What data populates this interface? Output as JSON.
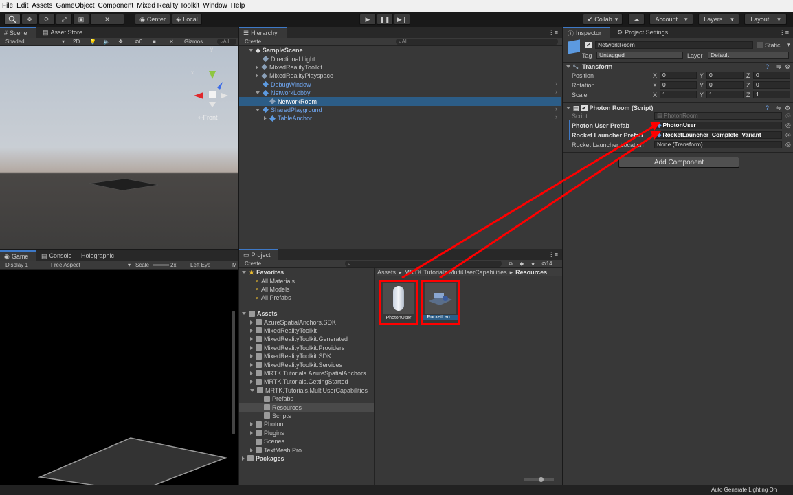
{
  "menu": [
    "File",
    "Edit",
    "Assets",
    "GameObject",
    "Component",
    "Mixed Reality Toolkit",
    "Window",
    "Help"
  ],
  "toolbar": {
    "center": "Center",
    "local": "Local",
    "collab": "Collab",
    "account": "Account",
    "layers": "Layers",
    "layout": "Layout"
  },
  "scene": {
    "tabs": [
      "Scene",
      "Asset Store"
    ],
    "shaded": "Shaded",
    "mode2d": "2D",
    "effects_count": "0",
    "gizmos": "Gizmos",
    "search_placeholder": "All",
    "gizmo_label": "Front",
    "axis_x": "x",
    "axis_y": "y"
  },
  "game": {
    "tabs": [
      "Game",
      "Console",
      "Holographic"
    ],
    "display": "Display 1",
    "aspect": "Free Aspect",
    "scale_label": "Scale",
    "scale_value": "2x",
    "eye": "Left Eye",
    "more": "M"
  },
  "hierarchy": {
    "tab": "Hierarchy",
    "create": "Create",
    "search_placeholder": "All",
    "scene_name": "SampleScene",
    "items": [
      {
        "label": "Directional Light"
      },
      {
        "label": "MixedRealityToolkit"
      },
      {
        "label": "MixedRealityPlayspace"
      },
      {
        "label": "DebugWindow"
      },
      {
        "label": "NetworkLobby"
      },
      {
        "label": "NetworkRoom"
      },
      {
        "label": "SharedPlayground"
      },
      {
        "label": "TableAnchor"
      }
    ]
  },
  "project": {
    "tab": "Project",
    "create": "Create",
    "badge_count": "14",
    "favorites_title": "Favorites",
    "favorites": [
      "All Materials",
      "All Models",
      "All Prefabs"
    ],
    "assets_title": "Assets",
    "folders": [
      "AzureSpatialAnchors.SDK",
      "MixedRealityToolkit",
      "MixedRealityToolkit.Generated",
      "MixedRealityToolkit.Providers",
      "MixedRealityToolkit.SDK",
      "MixedRealityToolkit.Services",
      "MRTK.Tutorials.AzureSpatialAnchors",
      "MRTK.Tutorials.GettingStarted",
      "MRTK.Tutorials.MultiUserCapabilities",
      "Prefabs",
      "Resources",
      "Scripts",
      "Photon",
      "Plugins",
      "Scenes",
      "TextMesh Pro",
      "Packages"
    ],
    "breadcrumb": [
      "Assets",
      "MRTK.Tutorials.MultiUserCapabilities",
      "Resources"
    ],
    "breadcrumb_sep": "▸",
    "assets": [
      {
        "label": "PhotonUser"
      },
      {
        "label": "RocketLau..."
      }
    ]
  },
  "inspector": {
    "tabs": [
      "Inspector",
      "Project Settings"
    ],
    "object_name": "NetworkRoom",
    "static_label": "Static",
    "tag_label": "Tag",
    "tag_value": "Untagged",
    "layer_label": "Layer",
    "layer_value": "Default",
    "transform": {
      "title": "Transform",
      "rows": [
        {
          "label": "Position",
          "x": "0",
          "y": "0",
          "z": "0"
        },
        {
          "label": "Rotation",
          "x": "0",
          "y": "0",
          "z": "0"
        },
        {
          "label": "Scale",
          "x": "1",
          "y": "1",
          "z": "1"
        }
      ],
      "x_label": "X",
      "y_label": "Y",
      "z_label": "Z"
    },
    "photon_room": {
      "title": "Photon Room (Script)",
      "script_label": "Script",
      "script_value": "PhotonRoom",
      "user_prefab_label": "Photon User Prefab",
      "user_prefab_value": "PhotonUser",
      "rocket_prefab_label": "Rocket Launcher Prefab",
      "rocket_prefab_value": "RocketLauncher_Complete_Variant",
      "rocket_location_label": "Rocket Launcher Location",
      "rocket_location_value": "None (Transform)"
    },
    "add_component": "Add Component"
  },
  "status": {
    "lighting": "Auto Generate Lighting On"
  },
  "colors": {
    "accent": "#3e79c7",
    "annotation": "#ff0000",
    "selection": "#2c5d87"
  }
}
